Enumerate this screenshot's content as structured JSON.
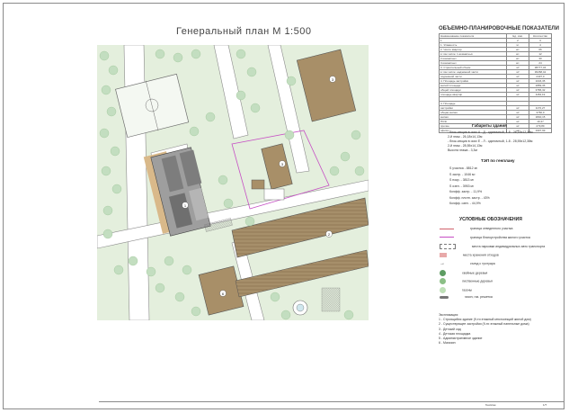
{
  "sheet": {
    "title": "Генеральный план М 1:500",
    "stamp_label": "Генплан",
    "page_number": "1/7"
  },
  "table": {
    "title": "ОБЪЕМНО-ПЛАНИРОВОЧНЫЕ ПОКАЗАТЕЛИ",
    "head": [
      "Наименование показателя",
      "Ед. изм.",
      "Количество"
    ],
    "index": [
      "1",
      "2",
      "3"
    ],
    "rows": [
      [
        "1. Этажность",
        "эт.",
        "4"
      ],
      [
        "2. Число квартир",
        "шт.",
        "66"
      ],
      [
        "в том числе: 1-комнатных",
        "шт.",
        "12"
      ],
      [
        "2-комнатных",
        "шт.",
        "30"
      ],
      [
        "3-комнатных",
        "шт.",
        "24"
      ],
      [
        "3. Строительный объем",
        "м³",
        "38777,34"
      ],
      [
        "в том числе: надземной части",
        "м³",
        "36268,42"
      ],
      [
        "подземной части",
        "м³",
        "2437,0"
      ],
      [
        "4. Площадь застройки",
        "м²",
        "1046,35"
      ],
      [
        "жилой площади",
        "м²",
        "1889,36"
      ],
      [
        "общей площади",
        "м²",
        "3786,32"
      ],
      [
        "площадь квартир",
        "м²",
        "1184,19"
      ],
      [
        "",
        "",
        ""
      ],
      [
        "4. Площадь",
        "",
        ""
      ],
      [
        "застройки",
        "м²",
        "1170,27"
      ],
      [
        "общая жилая",
        "м²",
        "3760,0"
      ],
      [
        "жилая",
        "м²",
        "1840,15"
      ],
      [
        "ПСЖ",
        "м²",
        "19,37"
      ],
      [
        "прочие",
        "м²",
        "279,89"
      ],
      [
        "офисы",
        "м²",
        "1997,99"
      ]
    ]
  },
  "dimensions": {
    "title": "Габариты здания",
    "lines": [
      "- блок-секция в осях А - Д - одиночный, 1-8 - 26,18х12,38м",
      "2-й этаж - 26,18х14,13м",
      "- блок-секция в осях Е - Л - одиночный, 1-8 - 28,55х12,38м",
      "2-й этаж - 28,55х14,13м",
      "Высота этажа - 3,3м"
    ]
  },
  "tep": {
    "title": "ТЭП по генплану",
    "lines": [
      "S участка - 8812 м²",
      "S застр. - 1046 м²",
      "S покр. - 3813 м²",
      "S озел. - 3953 м²",
      "Коэфф. застр. - 11,9%",
      "Коэфф. плотн. застр. - 43%",
      "Коэфф. озел. - 44,9%"
    ]
  },
  "legend": {
    "title": "УСЛОВНЫЕ ОБОЗНАЧЕНИЯ",
    "items": [
      {
        "label": "граница отведенного участка",
        "kind": "line-red",
        "color": "#d0606b"
      },
      {
        "label": "граница благоустройства жилого участка",
        "kind": "line-magenta",
        "color": "#c64fc4"
      },
      {
        "label": "места парковки индивидуальных авто транспорта",
        "kind": "rect-dash",
        "color": "#7a7a7a"
      },
      {
        "label": "места хранения отходов",
        "kind": "rect-fill",
        "color": "#e8a9a9"
      },
      {
        "label": "съезд с тротуара",
        "kind": "arrow",
        "color": "#444444"
      },
      {
        "label": "хвойные деревья",
        "kind": "circle-dark",
        "color": "#5d9c62"
      },
      {
        "label": "лиственные деревья",
        "kind": "circle-star",
        "color": "#8bbf86"
      },
      {
        "label": "газоны",
        "kind": "circle-light",
        "color": "#bfe0b8"
      },
      {
        "label": "газон, газ. решетка",
        "kind": "pill",
        "color": "#777777"
      }
    ]
  },
  "notes": {
    "title": "Экспликация:",
    "items": [
      "1 - Строящийся здание (9-ти этажный многосекций жилой дом)",
      "2 - Существующее застройки (9-ти этажный панельные дома)",
      "3 - Детский сад",
      "4 - Детская площадка",
      "5 - Административное здание",
      "6 - Магазин"
    ]
  },
  "map": {
    "building_numbers": [
      "1",
      "2",
      "3",
      "4",
      "5",
      "6"
    ],
    "colors": {
      "grass": "#e4efdd",
      "tree": "#c3dec0",
      "road": "#ffffff",
      "road_edge": "#8b8b8b",
      "existing": "#a88f68",
      "new_roof": "#7d7d7d",
      "new_roof_light": "#b5b5b5",
      "plot": "#c64fc4",
      "sand": "#d9b98a"
    }
  }
}
